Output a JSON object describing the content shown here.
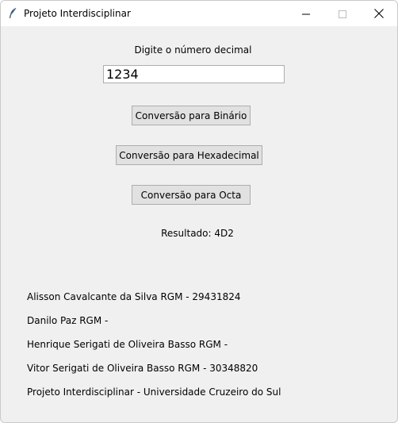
{
  "window": {
    "title": "Projeto Interdisciplinar",
    "controls": {
      "minimize_icon": "minimize-icon",
      "maximize_icon": "maximize-icon",
      "close_icon": "close-icon"
    }
  },
  "form": {
    "prompt_label": "Digite o número decimal",
    "input_value": "1234"
  },
  "buttons": {
    "binary": "Conversão para Binário",
    "hex": "Conversão para Hexadecimal",
    "octal": "Conversão para Octa"
  },
  "result": "Resultado: 4D2",
  "credits": [
    "Alisson Cavalcante da Silva RGM - 29431824",
    "Danilo Paz RGM -",
    "Henrique Serigati de Oliveira Basso RGM -",
    "Vitor Serigati de Oliveira Basso RGM - 30348820",
    "Projeto Interdisciplinar - Universidade Cruzeiro do Sul"
  ],
  "colors": {
    "window_bg": "#f0f0f0",
    "titlebar_bg": "#ffffff",
    "button_bg": "#e1e1e1",
    "button_border": "#adadad"
  }
}
